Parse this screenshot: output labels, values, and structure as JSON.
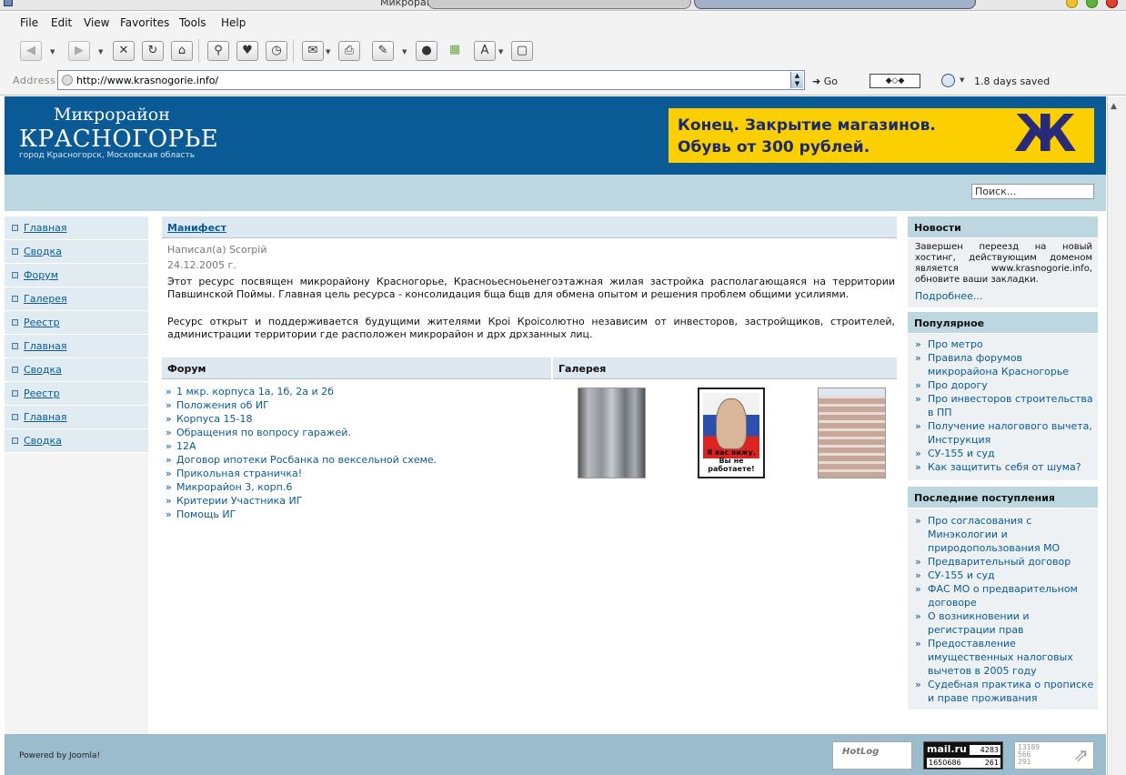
{
  "window": {
    "title": "Микрорайон"
  },
  "menu": [
    "File",
    "Edit",
    "View",
    "Favorites",
    "Tools",
    "Help"
  ],
  "toolbar": {
    "font_button": "A"
  },
  "address": {
    "label": "Address",
    "url": "http://www.krasnogorie.info/",
    "go": "Go",
    "saved": "1.8 days saved"
  },
  "site": {
    "logo_line1": "Микрорайон",
    "logo_line2": "КРАСНОГОРЬЕ",
    "logo_line3": "город Красногорск,  Московская область",
    "banner_line1": "Конец. Закрытие магазинов.",
    "banner_line2": "Обувь от 300 рублей.",
    "banner_logo": "Ж",
    "search_placeholder": "Поиск..."
  },
  "nav": [
    "Главная",
    "Сводка",
    "Форум",
    "Галерея",
    "Реестр",
    "Главная",
    "Сводка",
    "Реестр",
    "Главная",
    "Сводка"
  ],
  "article": {
    "title": "Манифест",
    "author": "Написал(а) Scorpiй",
    "date": "24.12.2005 г.",
    "para1": "Этот ресурс посвящен микрорайону Красногорье, Красноьесноьенегоэтажная жилая застройка располагающаяся на территории Павшинской Поймы. Главная цель ресурса - консолидация бща бщв для обмена опытом и решения проблем общими усилиями.",
    "para2": "Ресурс открыт и поддерживается будущими жителями Кроі Кроісолютно независим от инвесторов, застройщиков, строителей, администрации территории где расположен микрорайон и дрх дрхзанных лиц."
  },
  "forum": {
    "heading": "Форум",
    "items": [
      "1 мкр. корпуса 1а, 1б, 2а и 2б",
      "Положения об ИГ",
      "Корпуса 15-18",
      "Обращения по вопросу гаражей.",
      "12А",
      "Договор ипотеки Росбанка по вексельной схеме.",
      "Прикольная страничка!",
      "Микрорайон 3, корп.6",
      "Критерии Участника ИГ",
      "Помощь ИГ"
    ]
  },
  "gallery": {
    "heading": "Галерея",
    "poster_text": "Я вас вижу, Вы не работаете!"
  },
  "news": {
    "heading": "Новости",
    "text": "Завершен переезд на новый хостинг, действующим доменом является www.krasnogorie.info, обновите ваши закладки.",
    "more": "Подробнее..."
  },
  "popular": {
    "heading": "Популярное",
    "items": [
      "Про метро",
      "Правила форумов микрорайона Красногорье",
      "Про дорогу",
      "Про инвесторов строительства в ПП",
      "Получение налогового вычета, Инструкция",
      "СУ-155 и суд",
      "Как защитить себя от шума?"
    ]
  },
  "latest": {
    "heading": "Последние поступления",
    "items": [
      "Про согласования с Минэкологии и природопользования МО",
      "Предварительный договор",
      "СУ-155 и суд",
      "ФАС МО о предварительном договоре",
      "О возникновении и регистрации прав",
      "Предоставление имущественных налоговых вычетов в 2005 году",
      "Судебная практика о прописке и праве проживания"
    ]
  },
  "footer": {
    "powered": "Powered by Joomla!",
    "hotlog": "HotLog",
    "mailru": "mail.ru",
    "mailru_top": "4283",
    "mailru_bottom_left": "1650686",
    "mailru_bottom_right": "261",
    "counter3_line1": "13189",
    "counter3_line2": "566",
    "counter3_line3": "291"
  },
  "colors": {
    "header_blue": "#0a5a95",
    "banner_yellow": "#fcd000",
    "light_blue": "#bdd7e0",
    "link": "#0a5a95"
  }
}
